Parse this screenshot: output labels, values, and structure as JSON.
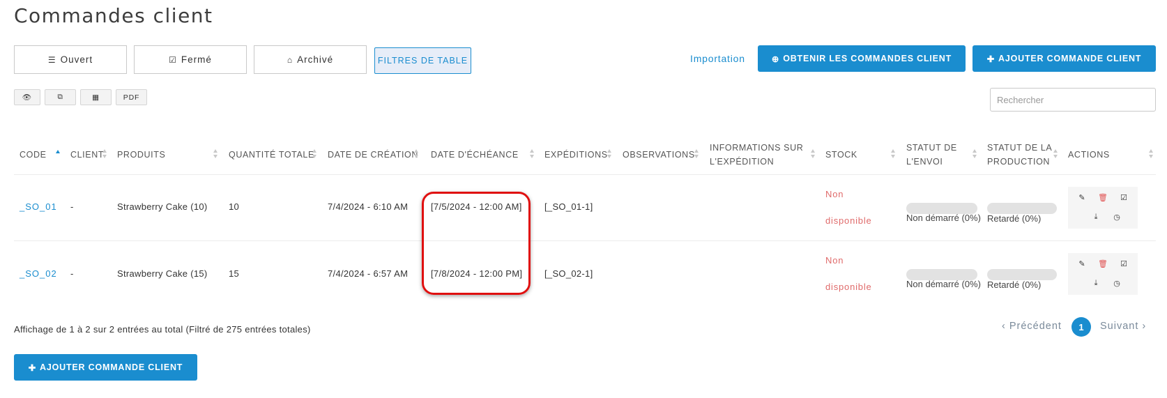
{
  "page": {
    "title": "Commandes client"
  },
  "tabs": [
    {
      "icon": "list-icon",
      "glyph": "☰",
      "label": "Ouvert"
    },
    {
      "icon": "checkbox-icon",
      "glyph": "☑",
      "label": "Fermé"
    },
    {
      "icon": "inbox-icon",
      "glyph": "⌂",
      "label": "Archivé"
    }
  ],
  "filter_button": {
    "label": "FILTRES DE TABLE"
  },
  "actions_top": {
    "import_label": "Importation",
    "get_orders_label": "OBTENIR LES COMMANDES CLIENT",
    "add_order_label": "AJOUTER COMMANDE CLIENT"
  },
  "toolbar": {
    "eye_glyph": "👁",
    "copy_glyph": "⧉",
    "table_glyph": "▦",
    "pdf_label": "PDF"
  },
  "search": {
    "placeholder": "Rechercher"
  },
  "table": {
    "headers": {
      "code": "CODE",
      "client": "CLIENT",
      "produits": "PRODUITS",
      "quantite": "QUANTITÉ TOTALE",
      "date_creation": "DATE DE CRÉATION",
      "date_echeance": "DATE D'ÉCHÉANCE",
      "expeditions": "EXPÉDITIONS",
      "observations": "OBSERVATIONS",
      "info_exp_1": "INFORMATIONS SUR",
      "info_exp_2": "L'EXPÉDITION",
      "stock": "STOCK",
      "statut_envoi_1": "STATUT DE",
      "statut_envoi_2": "L'ENVOI",
      "statut_prod_1": "STATUT DE LA",
      "statut_prod_2": "PRODUCTION",
      "actions": "ACTIONS"
    },
    "rows": [
      {
        "code": "_SO_01",
        "client": "-",
        "produits": "Strawberry Cake (10)",
        "quantite": "10",
        "date_creation": "7/4/2024 - 6:10 AM",
        "date_echeance": "[7/5/2024 - 12:00 AM]",
        "expeditions": "[_SO_01-1]",
        "stock_1": "Non",
        "stock_2": "disponible",
        "envoi_label": "Non démarré (0%)",
        "envoi_progress": 0,
        "prod_label": "Retardé (0%)",
        "prod_progress": 0
      },
      {
        "code": "_SO_02",
        "client": "-",
        "produits": "Strawberry Cake (15)",
        "quantite": "15",
        "date_creation": "7/4/2024 - 6:57 AM",
        "date_echeance": "[7/8/2024 - 12:00 PM]",
        "expeditions": "[_SO_02-1]",
        "stock_1": "Non",
        "stock_2": "disponible",
        "envoi_label": "Non démarré (0%)",
        "envoi_progress": 0,
        "prod_label": "Retardé (0%)",
        "prod_progress": 0
      }
    ],
    "action_icons": {
      "edit": "✎",
      "delete": "🗑",
      "check": "☑",
      "download": "⤓",
      "history": "◷"
    }
  },
  "footer": {
    "info": "Affichage de 1 à 2 sur 2 entrées au total (Filtré de 275 entrées totales)",
    "prev_label": "‹ Précédent",
    "current_page": "1",
    "next_label": "Suivant ›",
    "add_order_label": "AJOUTER COMMANDE CLIENT"
  },
  "colors": {
    "accent": "#1a8dcf",
    "danger": "#e06b6b",
    "highlight": "#e01010"
  }
}
